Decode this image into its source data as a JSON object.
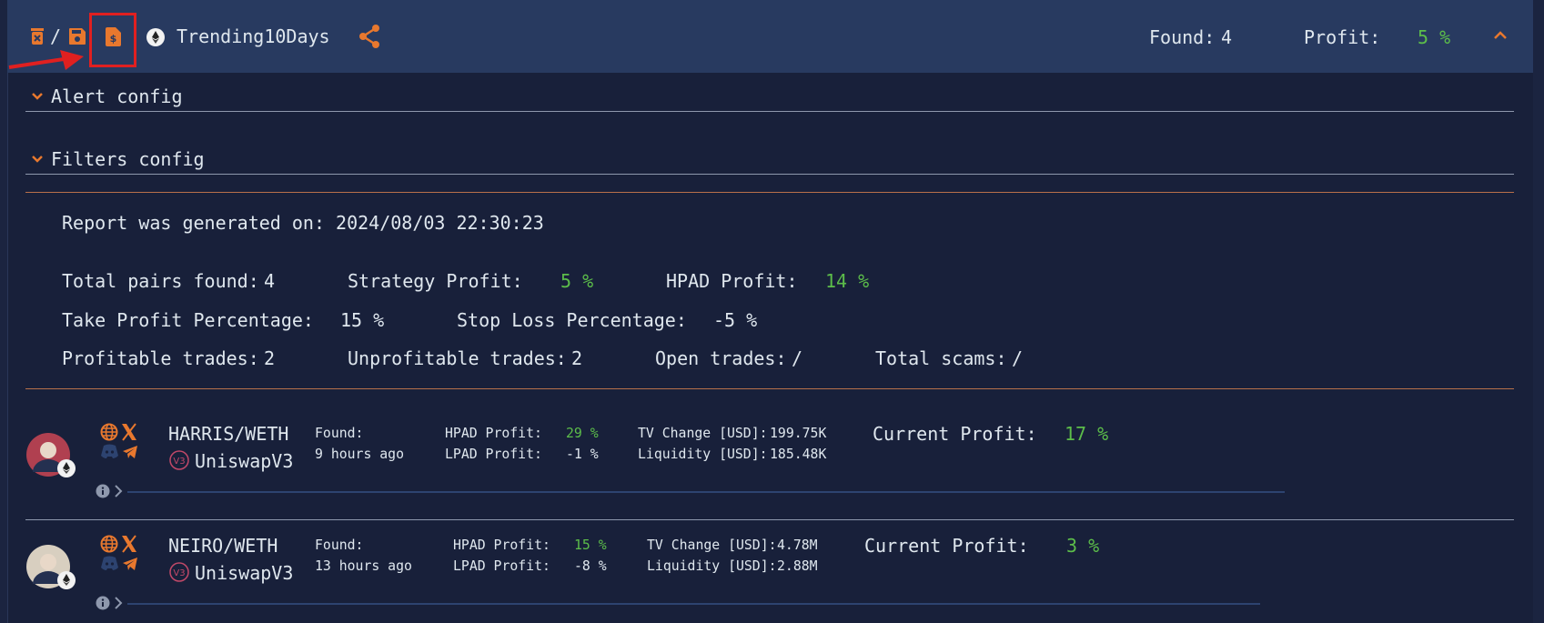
{
  "header": {
    "title": "Trending10Days",
    "separator": "/",
    "found_label": "Found:",
    "found_value": "4",
    "profit_label": "Profit:",
    "profit_value": "5 %"
  },
  "sections": {
    "alert_config": "Alert config",
    "filters_config": "Filters config"
  },
  "report": {
    "generated": "Report was generated on: 2024/08/03 22:30:23",
    "total_pairs_label": "Total pairs found:",
    "total_pairs": "4",
    "strategy_profit_label": "Strategy Profit:",
    "strategy_profit": "5 %",
    "hpad_profit_label": "HPAD Profit:",
    "hpad_profit": "14 %",
    "take_profit_label": "Take Profit Percentage:",
    "take_profit": "15 %",
    "stop_loss_label": "Stop Loss Percentage:",
    "stop_loss": "-5 %",
    "profitable_label": "Profitable trades:",
    "profitable": "2",
    "unprofitable_label": "Unprofitable trades:",
    "unprofitable": "2",
    "open_label": "Open trades:",
    "open": "/",
    "scams_label": "Total scams:",
    "scams": "/"
  },
  "pairs": [
    {
      "name": "HARRIS/WETH",
      "dex": "UniswapV3",
      "found_label": "Found:",
      "found": "9 hours ago",
      "hpad_label": "HPAD Profit:",
      "hpad": "29 %",
      "lpad_label": "LPAD Profit:",
      "lpad": "-1 %",
      "tv_label": "TV Change [USD]:",
      "tv": "199.75K",
      "liq_label": "Liquidity [USD]:",
      "liq": "185.48K",
      "current_label": "Current Profit:",
      "current": "17 %"
    },
    {
      "name": "NEIRO/WETH",
      "dex": "UniswapV3",
      "found_label": "Found:",
      "found": "13 hours ago",
      "hpad_label": "HPAD Profit:",
      "hpad": "15 %",
      "lpad_label": "LPAD Profit:",
      "lpad": "-8 %",
      "tv_label": "TV Change [USD]:",
      "tv": "4.78M",
      "liq_label": "Liquidity [USD]:",
      "liq": "2.88M",
      "current_label": "Current Profit:",
      "current": "3 %"
    }
  ],
  "colors": {
    "accent": "#e8782e",
    "positive": "#5cbd4a",
    "header_bg": "#283a60",
    "body_bg": "#18203a",
    "annotation": "#e02020"
  }
}
